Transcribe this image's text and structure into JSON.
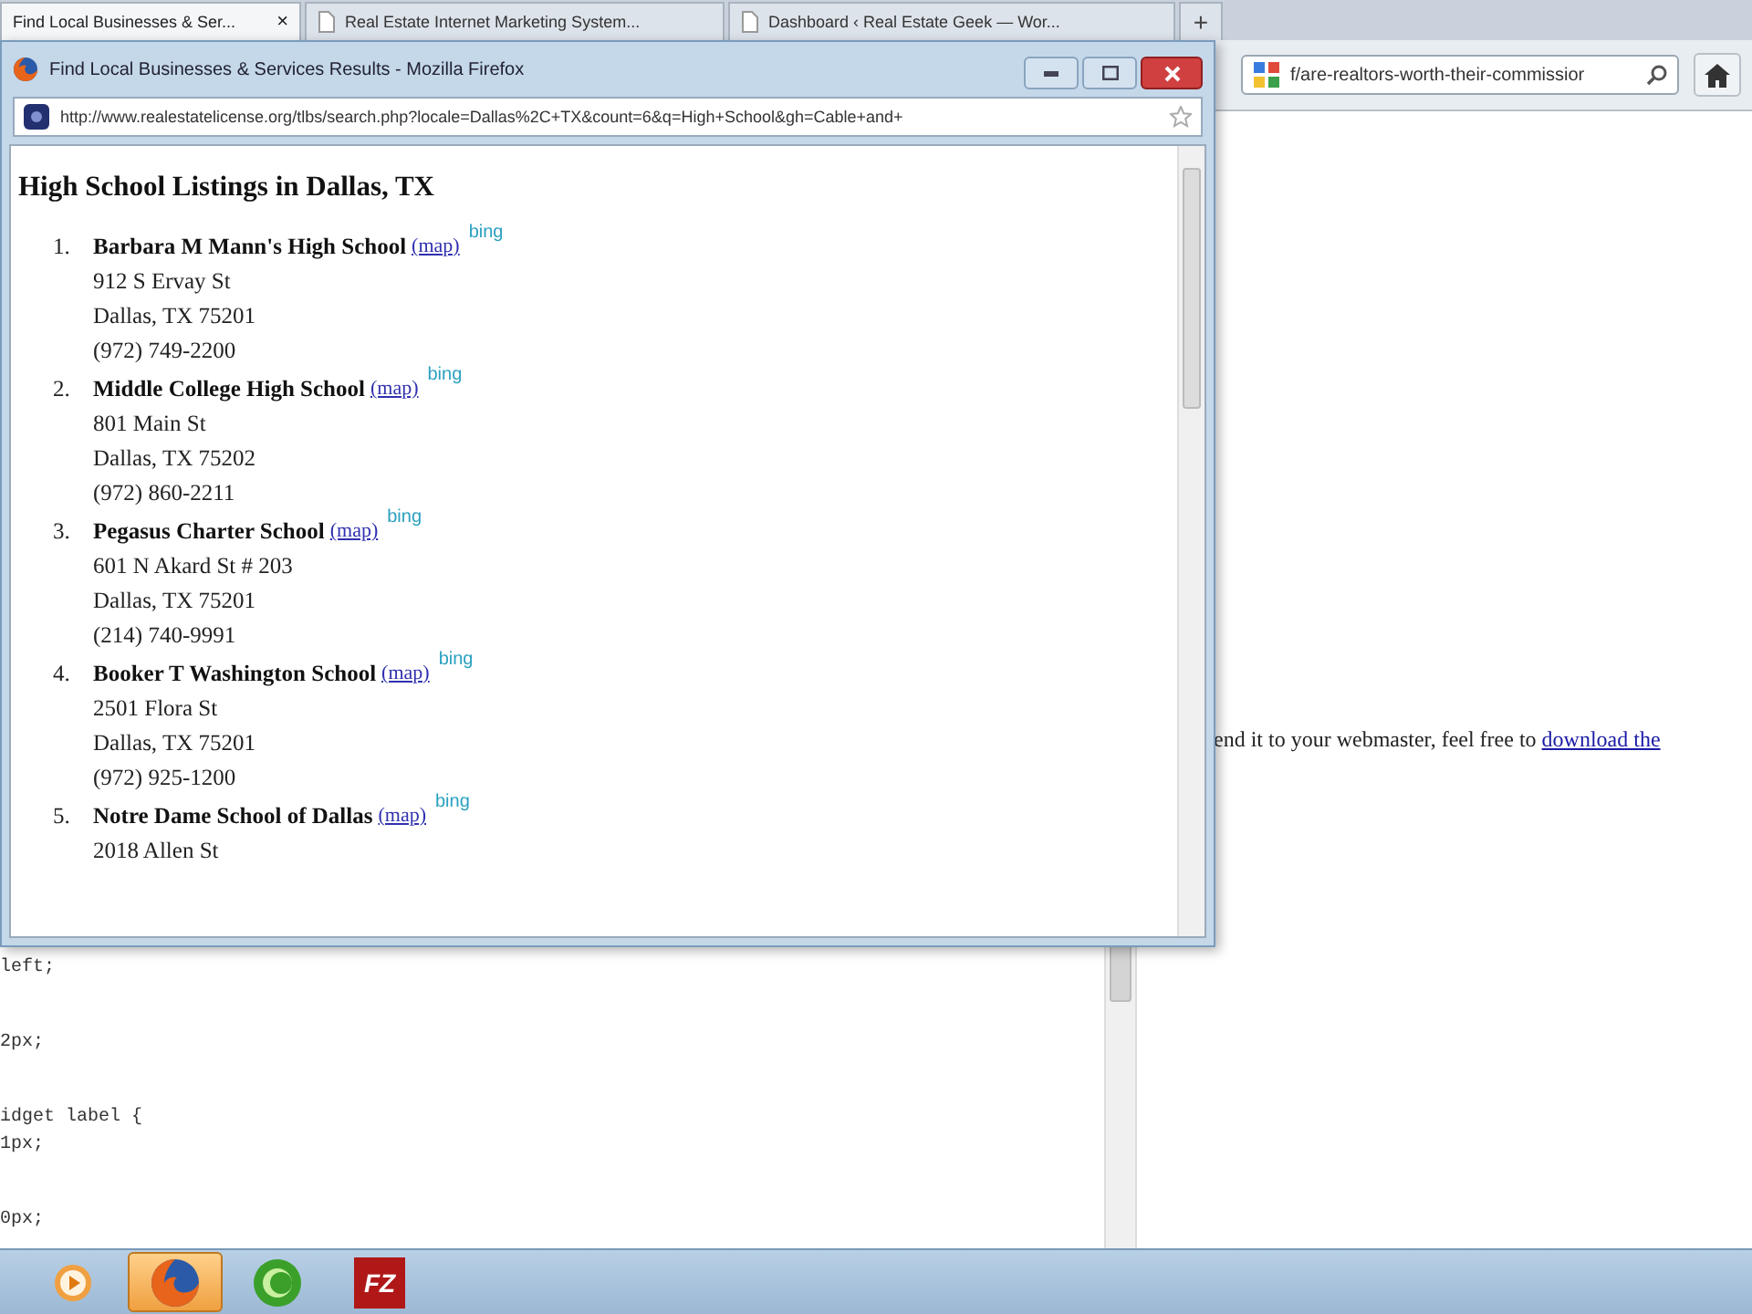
{
  "tabs": [
    {
      "label": "Find Local Businesses & Ser...",
      "selected": true,
      "close": "×"
    },
    {
      "label": "Real Estate Internet Marketing System...",
      "selected": false
    },
    {
      "label": "Dashboard ‹ Real Estate Geek — Wor...",
      "selected": false
    }
  ],
  "new_tab": "+",
  "search": {
    "value": "f/are-realtors-worth-their-commissior"
  },
  "page": {
    "text": "end it to your webmaster, feel free to",
    "link": "download the"
  },
  "code_blocks": [
    [
      "left;"
    ],
    [
      "2px;"
    ],
    [
      "idget label {",
      "1px;"
    ],
    [
      "0px;"
    ]
  ],
  "popup": {
    "title": "Find Local Businesses & Services Results - Mozilla Firefox",
    "url": "http://www.realestatelicense.org/tlbs/search.php?locale=Dallas%2C+TX&count=6&q=High+School&gh=Cable+and+",
    "heading": "High School Listings in Dallas, TX",
    "listings": [
      {
        "number": "1.",
        "name": "Barbara M Mann's High School",
        "map": "(map)",
        "badge": "bing",
        "lines": [
          "912 S Ervay St",
          "Dallas, TX 75201",
          "(972) 749-2200"
        ]
      },
      {
        "number": "2.",
        "name": "Middle College High School",
        "map": "(map)",
        "badge": "bing",
        "lines": [
          "801 Main St",
          "Dallas, TX 75202",
          "(972) 860-2211"
        ]
      },
      {
        "number": "3.",
        "name": "Pegasus Charter School",
        "map": "(map)",
        "badge": "bing",
        "lines": [
          "601 N Akard St # 203",
          "Dallas, TX 75201",
          "(214) 740-9991"
        ]
      },
      {
        "number": "4.",
        "name": "Booker T Washington School",
        "map": "(map)",
        "badge": "bing",
        "lines": [
          "2501 Flora St",
          "Dallas, TX 75201",
          "(972) 925-1200"
        ]
      },
      {
        "number": "5.",
        "name": "Notre Dame School of Dallas",
        "map": "(map)",
        "badge": "bing",
        "lines": [
          "2018 Allen St"
        ]
      }
    ]
  },
  "taskbar": [
    {
      "kind": "media",
      "selected": false
    },
    {
      "kind": "firefox",
      "selected": true
    },
    {
      "kind": "green",
      "selected": false
    },
    {
      "kind": "ftp",
      "selected": false,
      "label": "FZ"
    }
  ]
}
